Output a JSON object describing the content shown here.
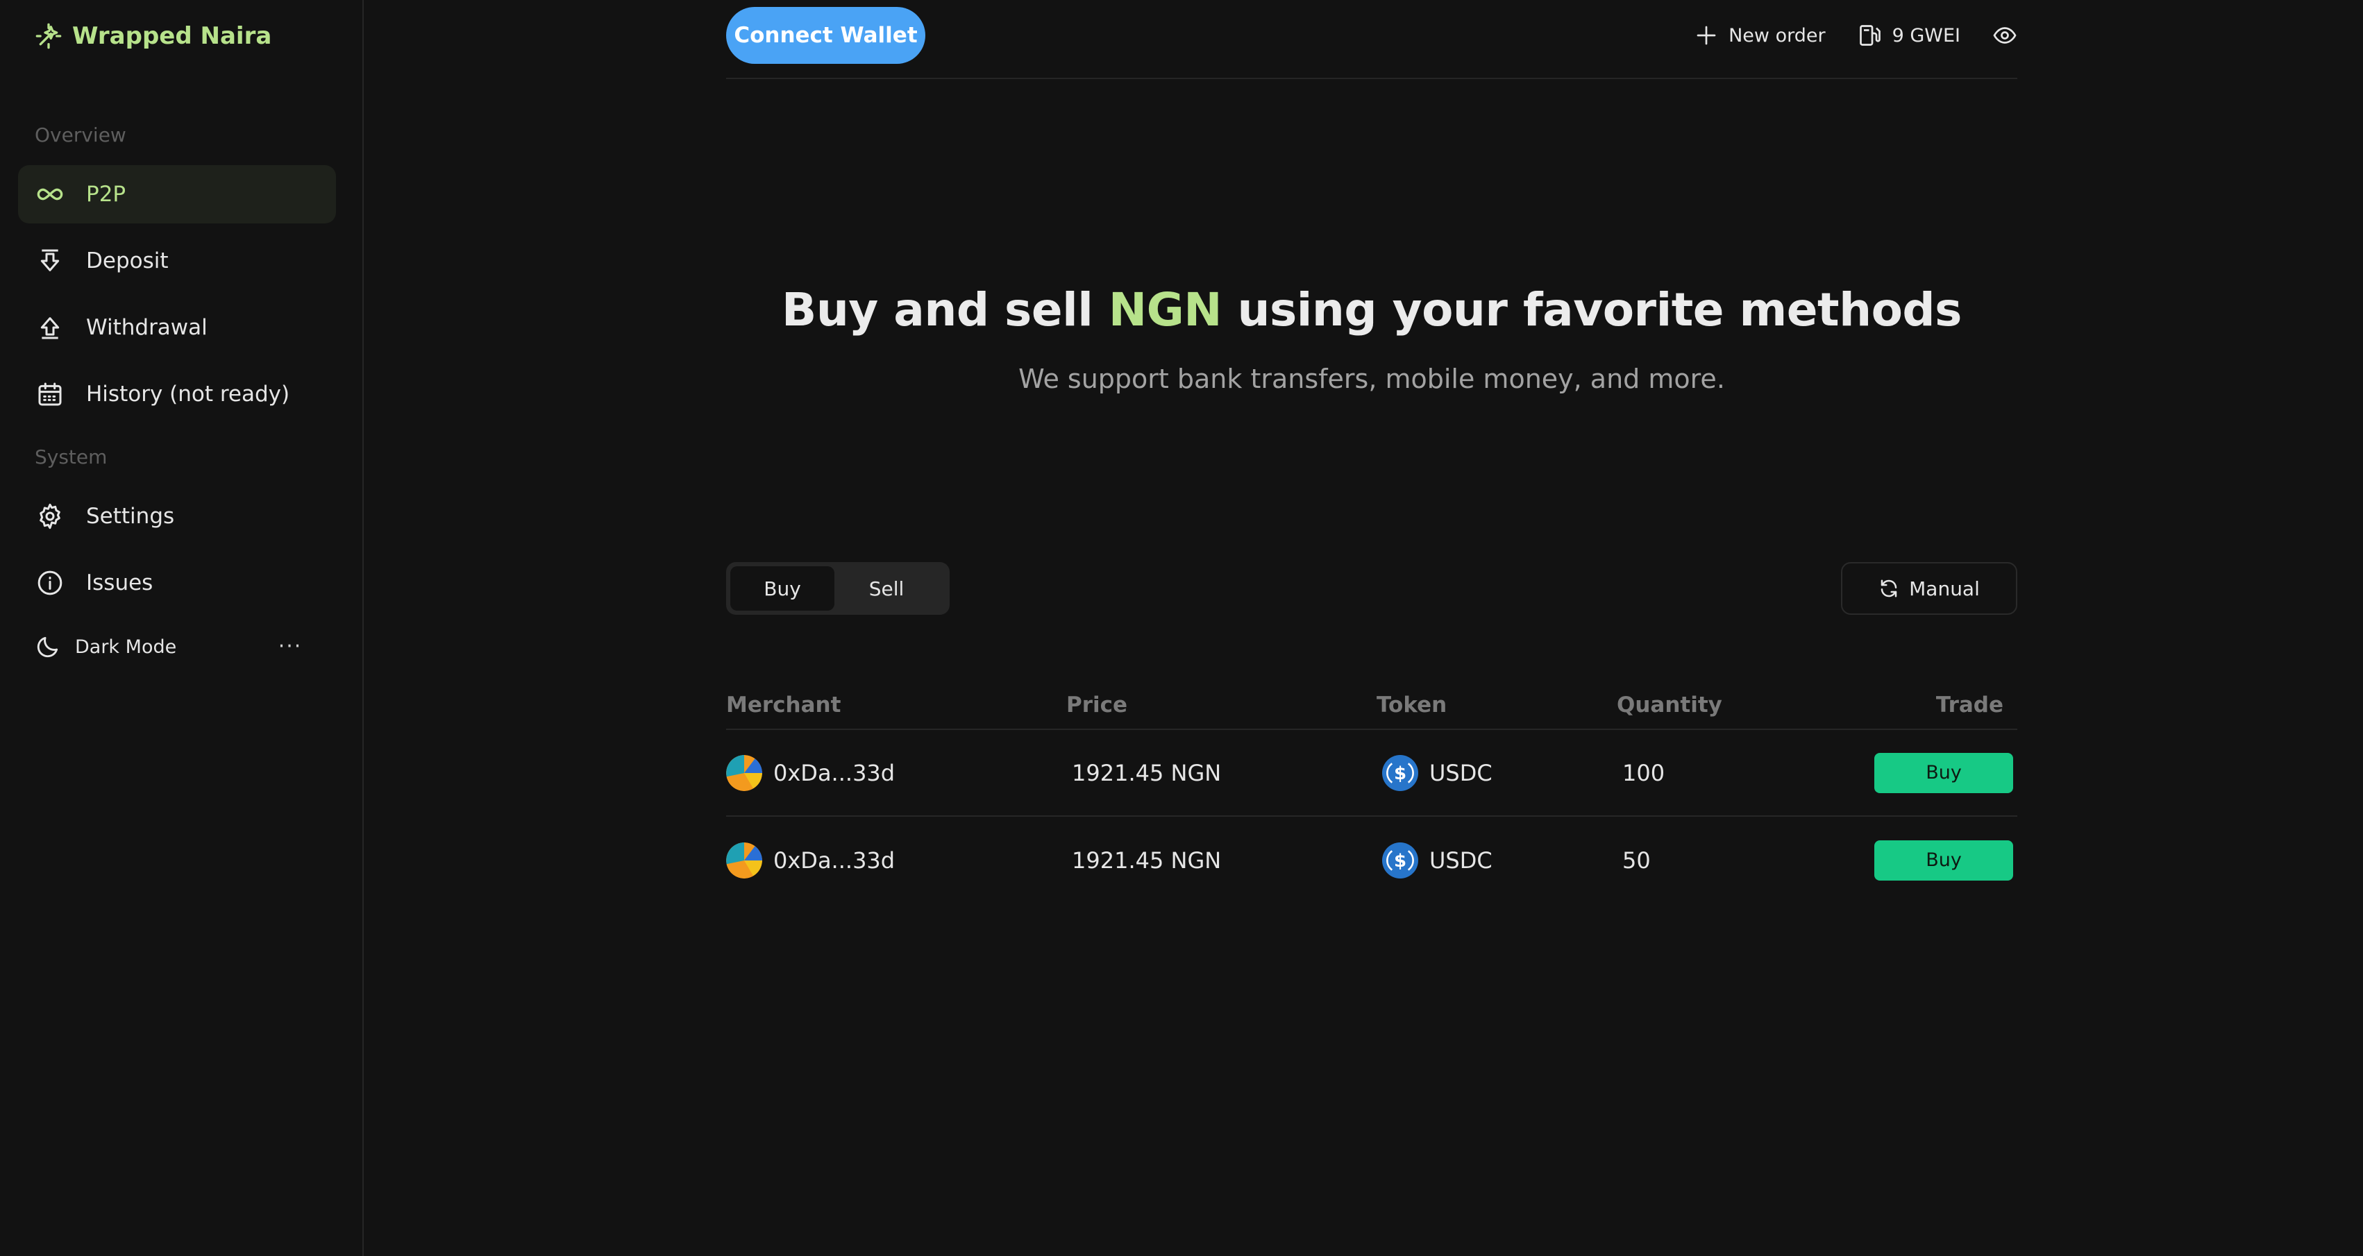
{
  "brand": {
    "name": "Wrapped Naira",
    "icon": "wand-sparkle-icon"
  },
  "sidebar": {
    "sections": [
      {
        "label": "Overview"
      },
      {
        "label": "System"
      }
    ],
    "items": [
      {
        "label": "P2P",
        "icon": "infinity-icon",
        "active": true
      },
      {
        "label": "Deposit",
        "icon": "arrow-down-to-tray-icon"
      },
      {
        "label": "Withdrawal",
        "icon": "arrow-up-from-tray-icon"
      },
      {
        "label": "History (not ready)",
        "icon": "calendar-icon"
      },
      {
        "label": "Settings",
        "icon": "gear-icon"
      },
      {
        "label": "Issues",
        "icon": "info-icon"
      }
    ],
    "dark_mode_label": "Dark Mode",
    "more_label": "···"
  },
  "topbar": {
    "connect_wallet": "Connect Wallet",
    "new_order": "New order",
    "gas": "9 GWEI"
  },
  "hero": {
    "title_pre": "Buy and sell ",
    "title_highlight": "NGN",
    "title_post": " using your favorite methods",
    "subtitle": "We support bank transfers, mobile money, and more."
  },
  "controls": {
    "tabs": [
      "Buy",
      "Sell"
    ],
    "active_tab": "Buy",
    "refresh_label": "Manual"
  },
  "table": {
    "headers": [
      "Merchant",
      "Price",
      "Token",
      "Quantity",
      "Trade"
    ],
    "rows": [
      {
        "merchant": "0xDa...33d",
        "price": "1921.45 NGN",
        "token": "USDC",
        "quantity": "100",
        "action": "Buy"
      },
      {
        "merchant": "0xDa...33d",
        "price": "1921.45 NGN",
        "token": "USDC",
        "quantity": "50",
        "action": "Buy"
      }
    ]
  },
  "colors": {
    "accent_green": "#b7e28b",
    "wallet_blue": "#4aa3f5",
    "buy_green": "#17c985",
    "background": "#121212"
  }
}
